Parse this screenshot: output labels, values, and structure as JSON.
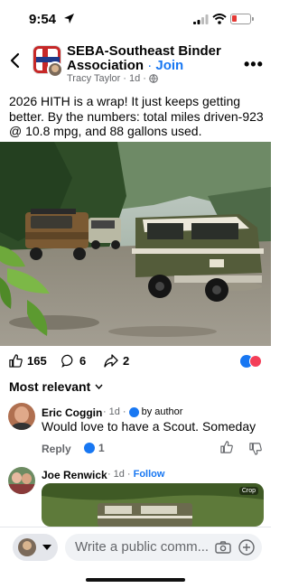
{
  "status_bar": {
    "time": "9:54",
    "battery_color": "#e53935"
  },
  "header": {
    "group_name": "SEBA-Southeast Binder Association",
    "separator": "·",
    "join_label": "Join",
    "author": "Tracy Taylor",
    "time_ago": "1d",
    "back_icon": "chevron-left-icon",
    "more_icon": "more-icon"
  },
  "post": {
    "text": "2026 HITH is a wrap!  It just keeps getting better.  By the numbers: total miles driven-923 @ 10.8 mpg, and 88 gallons used."
  },
  "reactions": {
    "likes": "165",
    "comments": "6",
    "shares": "2"
  },
  "comments": {
    "sort_label": "Most relevant",
    "items": [
      {
        "name": "Eric Coggin",
        "time_ago": "1d",
        "badge": "by author",
        "text": "Would love to have a Scout. Someday",
        "reply_label": "Reply",
        "like_count": "1"
      },
      {
        "name": "Joe Renwick",
        "time_ago": "1d",
        "follow_label": "Follow",
        "gif_label": "Crop"
      }
    ]
  },
  "composer": {
    "placeholder": "Write a public comm..."
  },
  "colors": {
    "accent": "#1877f2",
    "love": "#f33e58",
    "secondary_text": "#65676b"
  }
}
